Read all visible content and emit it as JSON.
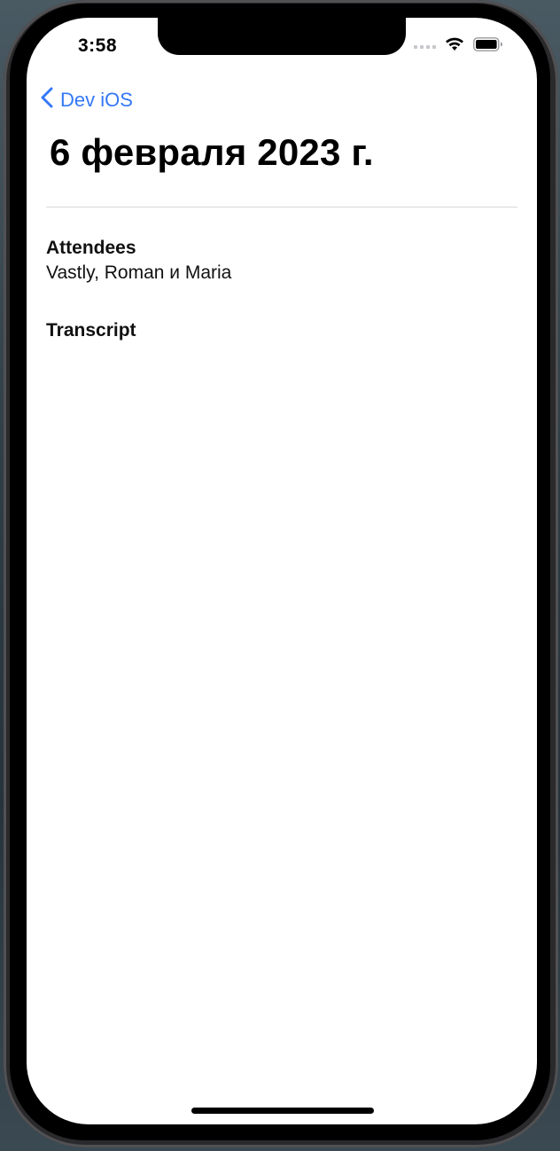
{
  "status_bar": {
    "time": "3:58"
  },
  "nav": {
    "back_label": "Dev iOS"
  },
  "page": {
    "title": "6 февраля 2023 г."
  },
  "attendees": {
    "heading": "Attendees",
    "value": "Vastly, Roman и Maria"
  },
  "transcript": {
    "heading": "Transcript"
  },
  "colors": {
    "accent": "#3478f6",
    "text": "#000000",
    "background": "#ffffff"
  },
  "icons": {
    "back": "chevron-left-icon",
    "cellular": "cellular-signal-icon",
    "wifi": "wifi-icon",
    "battery": "battery-icon"
  }
}
